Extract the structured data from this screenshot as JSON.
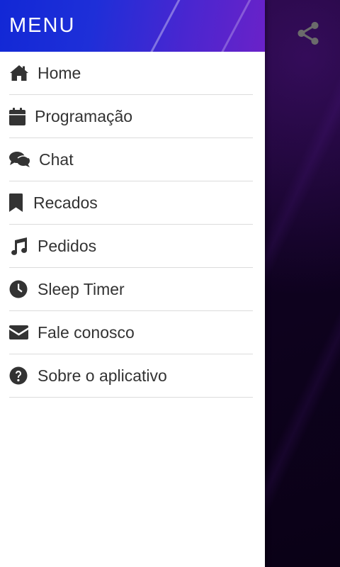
{
  "drawer": {
    "title": "MENU",
    "items": [
      {
        "label": "Home",
        "icon": "home-icon"
      },
      {
        "label": "Programação",
        "icon": "calendar-icon"
      },
      {
        "label": "Chat",
        "icon": "chat-icon"
      },
      {
        "label": "Recados",
        "icon": "bookmark-icon"
      },
      {
        "label": "Pedidos",
        "icon": "music-icon"
      },
      {
        "label": "Sleep Timer",
        "icon": "clock-icon"
      },
      {
        "label": "Fale conosco",
        "icon": "envelope-icon"
      },
      {
        "label": "Sobre o aplicativo",
        "icon": "question-icon"
      }
    ]
  },
  "toolbar": {
    "share_icon": "share-icon"
  },
  "colors": {
    "header_start": "#1228d6",
    "header_end": "#6a22c8",
    "background": "#0f0220",
    "text": "#333333"
  }
}
